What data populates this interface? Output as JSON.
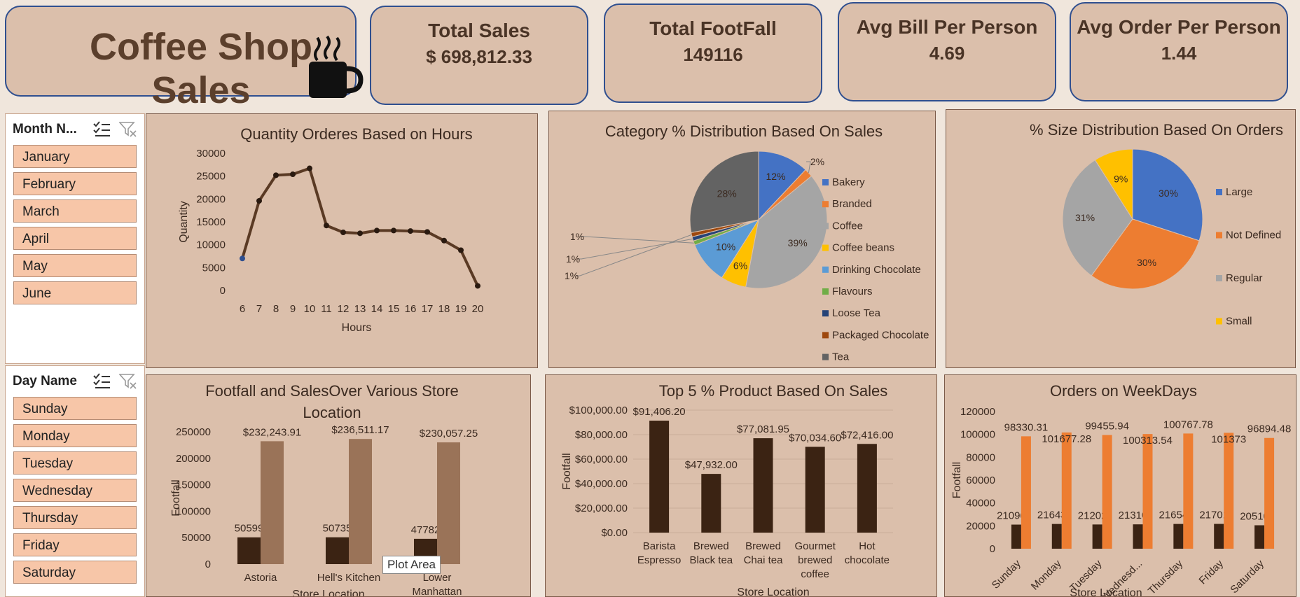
{
  "header": {
    "title": "Coffee Shop Sales"
  },
  "kpis": [
    {
      "label": "Total Sales",
      "value": "$ 698,812.33"
    },
    {
      "label": "Total FootFall",
      "value": "149116"
    },
    {
      "label": "Avg Bill Per Person",
      "value": "4.69"
    },
    {
      "label": "Avg Order Per Person",
      "value": "1.44"
    }
  ],
  "slicers": {
    "month": {
      "title": "Month N...",
      "items": [
        "January",
        "February",
        "March",
        "April",
        "May",
        "June"
      ]
    },
    "day": {
      "title": "Day Name",
      "items": [
        "Sunday",
        "Monday",
        "Tuesday",
        "Wednesday",
        "Thursday",
        "Friday",
        "Saturday"
      ]
    }
  },
  "tooltip": {
    "text": "Plot Area"
  },
  "colors": {
    "brown_dark": "#3b2313",
    "brown_mid": "#9a7358",
    "orange": "#ed7d31",
    "blue": "#4472c4",
    "gray": "#a5a5a5",
    "yellow": "#ffc000",
    "panel_bg": "#dbbfab"
  },
  "chart_data": [
    {
      "id": "hours",
      "type": "line",
      "title": "Quantity Orderes Based on Hours",
      "xlabel": "Hours",
      "ylabel": "Quantity",
      "x": [
        6,
        7,
        8,
        9,
        10,
        11,
        12,
        13,
        14,
        15,
        16,
        17,
        18,
        19,
        20
      ],
      "values": [
        7000,
        19600,
        25200,
        25400,
        26700,
        14200,
        12700,
        12500,
        13100,
        13100,
        13000,
        12800,
        10900,
        8800,
        1000
      ],
      "ylim": [
        0,
        30000
      ],
      "yticks": [
        "0",
        "5000",
        "10000",
        "15000",
        "20000",
        "25000",
        "30000"
      ]
    },
    {
      "id": "category",
      "type": "pie",
      "title": "Category % Distribution Based On Sales",
      "labels": [
        "Bakery",
        "Branded",
        "Coffee",
        "Coffee beans",
        "Drinking Chocolate",
        "Flavours",
        "Loose Tea",
        "Packaged Chocolate",
        "Tea"
      ],
      "values": [
        12,
        2,
        39,
        6,
        10,
        1,
        1,
        1,
        28
      ],
      "data_labels": [
        "12%",
        "2%",
        "39%",
        "6%",
        "10%",
        "1%",
        "1%",
        "1%",
        "28%"
      ],
      "colors": [
        "#4472c4",
        "#ed7d31",
        "#a5a5a5",
        "#ffc000",
        "#5b9bd5",
        "#70ad47",
        "#264478",
        "#9e480e",
        "#636363"
      ],
      "legend": "right"
    },
    {
      "id": "size",
      "type": "pie",
      "title": "% Size Distribution Based On Orders",
      "labels": [
        "Large",
        "Not Defined",
        "Regular",
        "Small"
      ],
      "values": [
        30,
        30,
        31,
        9
      ],
      "data_labels": [
        "30%",
        "30%",
        "31%",
        "9%"
      ],
      "colors": [
        "#4472c4",
        "#ed7d31",
        "#a5a5a5",
        "#ffc000"
      ],
      "legend": "right"
    },
    {
      "id": "store",
      "type": "bar",
      "title": "Footfall and SalesOver Various Store Location",
      "xlabel": "Store Location",
      "ylabel": "Footfall",
      "categories": [
        "Astoria",
        "Hell's Kitchen",
        "Lower Manhattan"
      ],
      "series": [
        {
          "values": [
            50599,
            50735,
            47782
          ],
          "labels": [
            "50599",
            "50735",
            "47782"
          ]
        },
        {
          "values": [
            232243.91,
            236511.17,
            230057.25
          ],
          "labels": [
            "$232,243.91",
            "$236,511.17",
            "$230,057.25"
          ]
        }
      ],
      "ylim": [
        0,
        250000
      ],
      "yticks": [
        "0",
        "50000",
        "100000",
        "150000",
        "200000",
        "250000"
      ]
    },
    {
      "id": "products",
      "type": "bar",
      "title": "Top 5 % Product Based On Sales",
      "xlabel": "Store Location",
      "ylabel": "Footfall",
      "categories": [
        "Barista Espresso",
        "Brewed Black tea",
        "Brewed Chai tea",
        "Gourmet brewed coffee",
        "Hot chocolate"
      ],
      "values": [
        91406.2,
        47932.0,
        77081.95,
        70034.6,
        72416.0
      ],
      "labels": [
        "$91,406.20",
        "$47,932.00",
        "$77,081.95",
        "$70,034.60",
        "$72,416.00"
      ],
      "ylim": [
        0,
        100000
      ],
      "yticks": [
        "$0.00",
        "$20,000.00",
        "$40,000.00",
        "$60,000.00",
        "$80,000.00",
        "$100,000.00"
      ]
    },
    {
      "id": "weekdays",
      "type": "bar",
      "title": "Orders on WeekDays",
      "xlabel": "Store Location",
      "ylabel": "Footfall",
      "categories": [
        "Sunday",
        "Monday",
        "Tuesday",
        "Wednesd...",
        "Thursday",
        "Friday",
        "Saturday"
      ],
      "series": [
        {
          "values": [
            21096,
            21643,
            21202,
            21310,
            21654,
            21701,
            20510
          ],
          "labels": [
            "21096",
            "21643",
            "21202",
            "21310",
            "21654",
            "21701",
            "20510"
          ]
        },
        {
          "values": [
            98330.31,
            101677.28,
            99455.94,
            100313.54,
            100767.78,
            101373,
            96894.48
          ],
          "labels": [
            "98330.31",
            "101677.28",
            "99455.94",
            "100313.54",
            "100767.78",
            "101373",
            "96894.48"
          ]
        }
      ],
      "ylim": [
        0,
        120000
      ],
      "yticks": [
        "0",
        "20000",
        "40000",
        "60000",
        "80000",
        "100000",
        "120000"
      ]
    }
  ]
}
